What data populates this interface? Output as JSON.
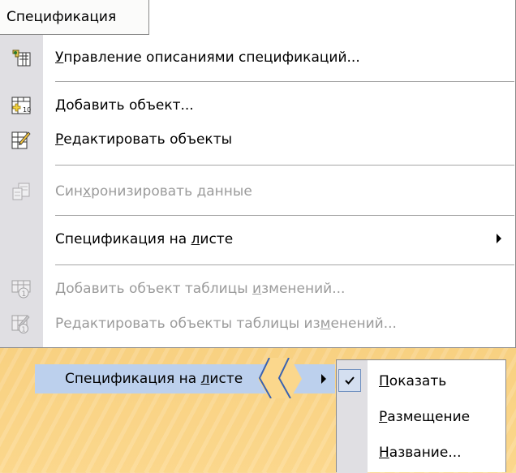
{
  "menu": {
    "title": "Спецификация",
    "items": [
      {
        "pre": "",
        "key": "У",
        "post": "правление описаниями спецификаций...",
        "icon": "spec-descriptions-icon",
        "disabled": false
      },
      {
        "pre": "",
        "key": "Д",
        "post": "обавить объект...",
        "icon": "add-object-icon",
        "disabled": false
      },
      {
        "pre": "",
        "key": "Р",
        "post": "едактировать объекты",
        "icon": "edit-objects-icon",
        "disabled": false
      },
      {
        "pre": "Син",
        "key": "х",
        "post": "ронизировать данные",
        "icon": "sync-data-icon",
        "disabled": true
      },
      {
        "pre": "Спецификация на ",
        "key": "л",
        "post": "исте",
        "icon": "",
        "disabled": false,
        "submenu": true
      },
      {
        "pre": "Добавить объект таблицы ",
        "key": "и",
        "post": "зменений...",
        "icon": "add-change-table-object-icon",
        "disabled": true
      },
      {
        "pre": "Редактировать объекты таблицы из",
        "key": "м",
        "post": "енений...",
        "icon": "edit-change-table-objects-icon",
        "disabled": true
      }
    ]
  },
  "cascade": {
    "parent": {
      "pre": "Спецификация на ",
      "key": "л",
      "post": "исте"
    },
    "submenu": [
      {
        "pre": "",
        "key": "П",
        "post": "оказать",
        "checked": true
      },
      {
        "pre": "",
        "key": "Р",
        "post": "азмещение",
        "checked": false
      },
      {
        "pre": "",
        "key": "Н",
        "post": "азвание...",
        "checked": false
      }
    ]
  },
  "colors": {
    "background": "#fbd78c",
    "menu_bg": "#ffffff",
    "gutter": "#e0dfe3",
    "highlight": "#bcd0ed",
    "disabled_text": "#9b9b9b"
  }
}
